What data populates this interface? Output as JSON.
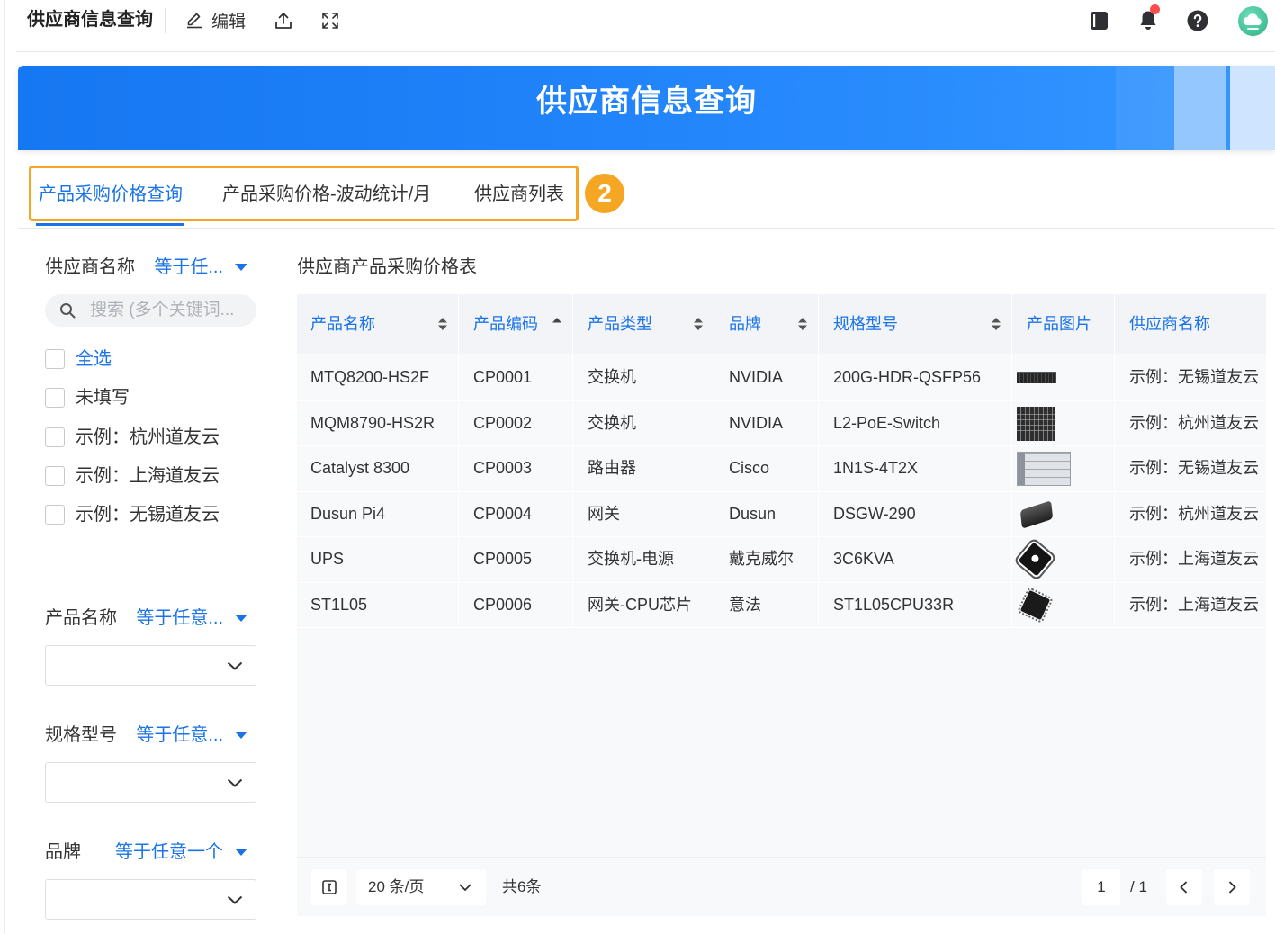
{
  "app": {
    "title": "供应商信息查询",
    "edit_label": "编辑"
  },
  "banner": {
    "title": "供应商信息查询"
  },
  "tabs": [
    {
      "label": "产品采购价格查询",
      "active": true
    },
    {
      "label": "产品采购价格-波动统计/月",
      "active": false
    },
    {
      "label": "供应商列表",
      "active": false
    }
  ],
  "step_badge": "2",
  "filters": {
    "supplier": {
      "label": "供应商名称",
      "operator": "等于任...",
      "search_placeholder": "搜索 (多个关键词...",
      "select_all_label": "全选",
      "options": [
        "未填写",
        "示例：杭州道友云",
        "示例：上海道友云",
        "示例：无锡道友云"
      ],
      "checked": [
        false,
        false,
        false,
        false,
        false
      ]
    },
    "product_name": {
      "label": "产品名称",
      "operator": "等于任意..."
    },
    "spec": {
      "label": "规格型号",
      "operator": "等于任意..."
    },
    "brand": {
      "label": "品牌",
      "operator": "等于任意一个"
    }
  },
  "table": {
    "title": "供应商产品采购价格表",
    "columns": [
      {
        "label": "产品名称",
        "sort_icon": "sort-both-icon"
      },
      {
        "label": "产品编码",
        "sort_icon": "sort-asc-icon"
      },
      {
        "label": "产品类型",
        "sort_icon": "sort-both-icon"
      },
      {
        "label": "品牌",
        "sort_icon": "sort-both-icon"
      },
      {
        "label": "规格型号",
        "sort_icon": "sort-both-icon"
      },
      {
        "label": "产品图片"
      },
      {
        "label": "供应商名称"
      }
    ],
    "rows": [
      {
        "name": "MTQ8200-HS2F",
        "code": "CP0001",
        "type": "交换机",
        "brand": "NVIDIA",
        "spec": "200G-HDR-QSFP56",
        "image": "rack-switch-image",
        "supplier": "示例：无锡道友云"
      },
      {
        "name": "MQM8790-HS2R",
        "code": "CP0002",
        "type": "交换机",
        "brand": "NVIDIA",
        "spec": "L2-PoE-Switch",
        "image": "port-switch-image",
        "supplier": "示例：杭州道友云"
      },
      {
        "name": "Catalyst 8300",
        "code": "CP0003",
        "type": "路由器",
        "brand": "Cisco",
        "spec": "1N1S-4T2X",
        "image": "router-image",
        "supplier": "示例：无锡道友云"
      },
      {
        "name": "Dusun Pi4",
        "code": "CP0004",
        "type": "网关",
        "brand": "Dusun",
        "spec": "DSGW-290",
        "image": "gateway-image",
        "supplier": "示例：杭州道友云"
      },
      {
        "name": "UPS",
        "code": "CP0005",
        "type": "交换机-电源",
        "brand": "戴克威尔",
        "spec": "3C6KVA",
        "image": "power-module-image",
        "supplier": "示例：上海道友云"
      },
      {
        "name": "ST1L05",
        "code": "CP0006",
        "type": "网关-CPU芯片",
        "brand": "意法",
        "spec": "ST1L05CPU33R",
        "image": "chip-image",
        "supplier": "示例：上海道友云"
      }
    ]
  },
  "pagination": {
    "page_size": "20 条/页",
    "total": "共6条",
    "current_page": "1",
    "page_count": "/ 1"
  },
  "colors": {
    "primary": "#1a73e8",
    "highlight": "#f5a623",
    "notification": "#ff4d4f",
    "banner": "#1677f2"
  }
}
